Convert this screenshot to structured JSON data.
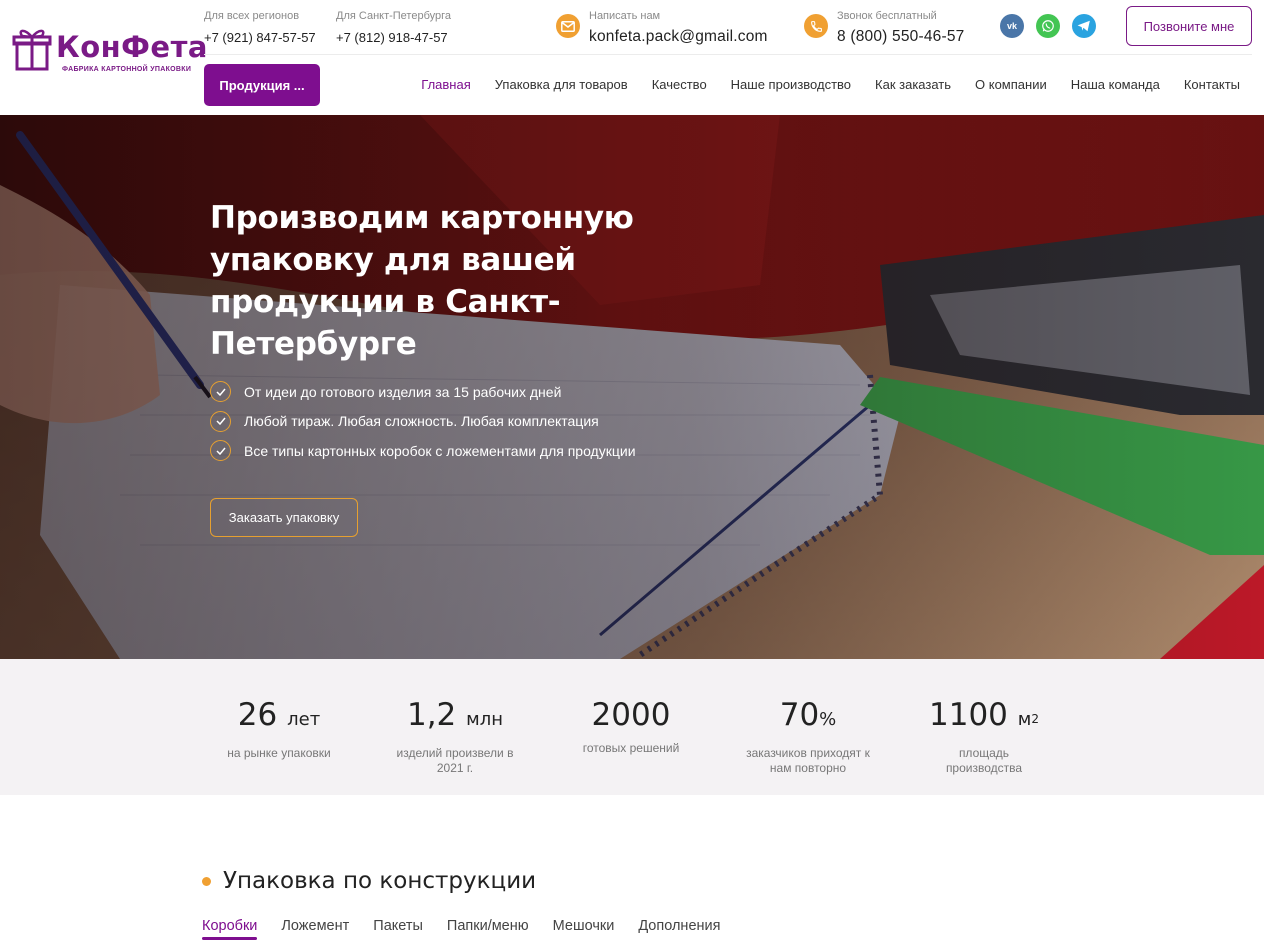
{
  "brand": {
    "name": "КонФета",
    "tagline": "ФАБРИКА КАРТОННОЙ УПАКОВКИ",
    "color": "#7e0e8f"
  },
  "header": {
    "phone_regions": {
      "label": "Для всех регионов",
      "value": "+7 (921) 847-57-57"
    },
    "phone_spb": {
      "label": "Для Санкт-Петербурга",
      "value": "+7 (812) 918-47-57"
    },
    "email": {
      "label": "Написать нам",
      "value": "konfeta.pack@gmail.com",
      "icon": "mail-icon"
    },
    "free_call": {
      "label": "Звонок бесплатный",
      "value": "8 (800) 550-46-57",
      "icon": "phone-icon"
    },
    "socials": [
      {
        "name": "vk-icon",
        "color": "#4a76a8"
      },
      {
        "name": "whatsapp-icon",
        "color": "#43c553"
      },
      {
        "name": "telegram-icon",
        "color": "#2aa3e0"
      }
    ],
    "call_button": "Позвоните мне",
    "products_button": "Продукция ..."
  },
  "nav": [
    {
      "label": "Главная",
      "active": true
    },
    {
      "label": "Упаковка для товаров"
    },
    {
      "label": "Качество"
    },
    {
      "label": "Наше производство"
    },
    {
      "label": "Как заказать"
    },
    {
      "label": "О компании"
    },
    {
      "label": "Наша команда"
    },
    {
      "label": "Контакты"
    }
  ],
  "hero": {
    "title": "Производим картонную упаковку для вашей продукции в Санкт-Петербурге",
    "bullets": [
      "От идеи до готового изделия за 15 рабочих дней",
      "Любой тираж. Любая сложность. Любая комплектация",
      "Все типы картонных коробок с ложементами для продукции"
    ],
    "cta": "Заказать упаковку",
    "accent": "#e6a030"
  },
  "stats": [
    {
      "number": "26",
      "unit": "лет",
      "sup": "",
      "label": "на рынке упаковки"
    },
    {
      "number": "1,2",
      "unit": "млн",
      "sup": "",
      "label": "изделий произвели в 2021 г."
    },
    {
      "number": "2000",
      "unit": "",
      "sup": "",
      "label": "готовых решений"
    },
    {
      "number": "70",
      "unit": "%",
      "sup": "",
      "label": "заказчиков приходят к нам повторно"
    },
    {
      "number": "1100",
      "unit": "м",
      "sup": "2",
      "label": "площадь производства"
    }
  ],
  "section": {
    "title": "Упаковка по конструкции",
    "tabs": [
      {
        "label": "Коробки",
        "active": true
      },
      {
        "label": "Ложемент"
      },
      {
        "label": "Пакеты"
      },
      {
        "label": "Папки/меню"
      },
      {
        "label": "Мешочки"
      },
      {
        "label": "Дополнения"
      }
    ]
  }
}
